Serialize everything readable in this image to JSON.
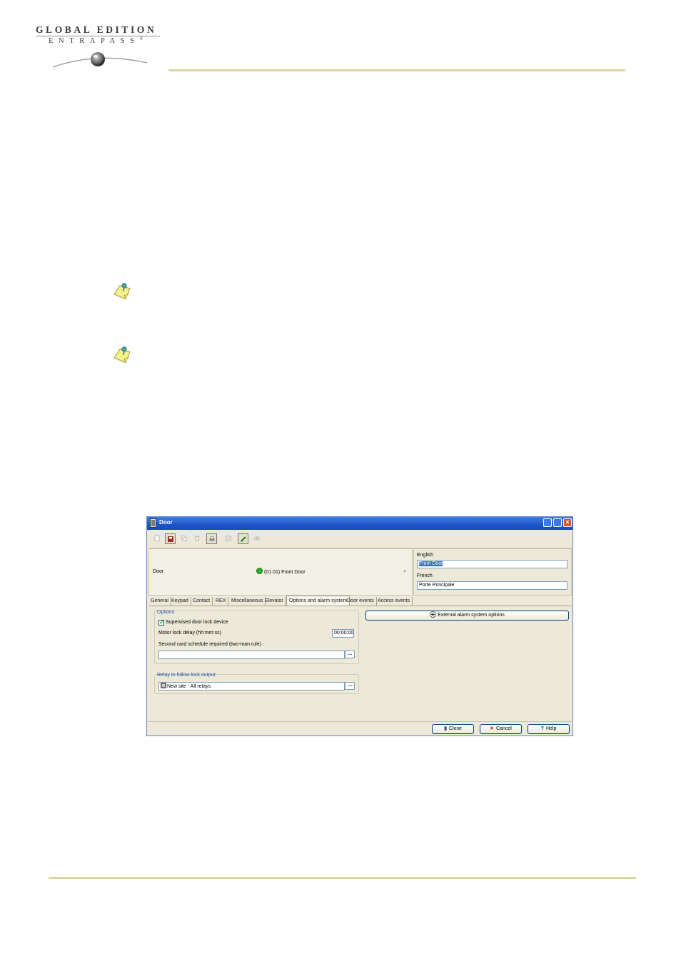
{
  "brand": {
    "line1": "GLOBAL EDITION",
    "line2": "ENTRAPASS",
    "trademark": "®",
    "rule_color": "#d9d7a0"
  },
  "dialog": {
    "title": "Door",
    "title_bar_color": "#1e55c8",
    "toolbar": [
      "new-icon",
      "save-icon",
      "copy-icon",
      "delete-icon",
      "print-icon",
      "grid-icon",
      "link-icon",
      "find-icon"
    ],
    "door": {
      "label": "Door",
      "value": "(01.01) Front Door",
      "status_color": "#2bb22b"
    },
    "languages": {
      "english_label": "English",
      "english_value": "Front Door",
      "french_label": "French",
      "french_value": "Porte Principale"
    },
    "tabs": [
      "General",
      "Keypad",
      "Contact",
      "REX",
      "Miscellaneous",
      "Elevator",
      "Options and alarm system",
      "Door events",
      "Access events"
    ],
    "active_tab": "Options and alarm system",
    "options": {
      "group_title": "Options",
      "supervised_label": "Supervised door lock device",
      "supervised_checked": true,
      "motor_delay_label": "Motor lock delay (hh:mm:ss)",
      "motor_delay_value": "00:00:00",
      "second_card_label": "Second card schedule required (two-man rule)",
      "second_card_value": ""
    },
    "relay": {
      "group_title": "Relay to follow lock output",
      "value": "New site - All relays"
    },
    "external_alarm_button": "External alarm system options",
    "buttons": {
      "close": "Close",
      "cancel": "Cancel",
      "help": "Help"
    }
  }
}
